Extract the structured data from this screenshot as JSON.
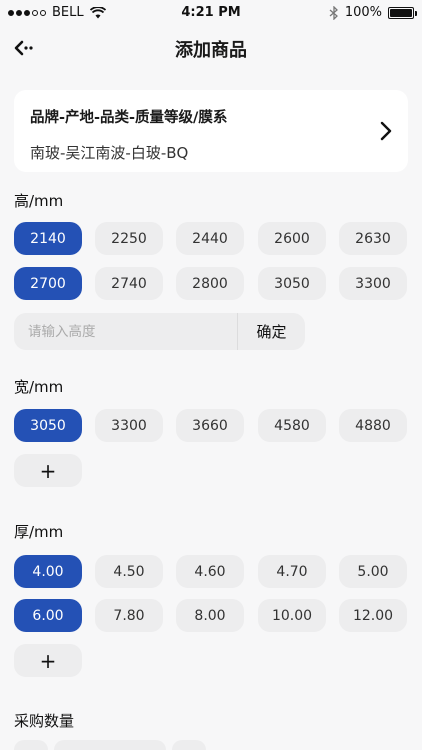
{
  "status_bar": {
    "carrier": "BELL",
    "time": "4:21 PM",
    "battery": "100%"
  },
  "nav": {
    "title": "添加商品"
  },
  "card": {
    "title": "品牌-产地-品类-质量等级/膜系",
    "value": "南玻-吴江南波-白玻-BQ"
  },
  "height": {
    "label": "高/mm",
    "options": [
      "2140",
      "2250",
      "2440",
      "2600",
      "2630",
      "2700",
      "2740",
      "2800",
      "3050",
      "3300"
    ],
    "selected": [
      "2140",
      "2700"
    ],
    "input_placeholder": "请输入高度",
    "confirm_label": "确定"
  },
  "width": {
    "label": "宽/mm",
    "options": [
      "3050",
      "3300",
      "3660",
      "4580",
      "4880"
    ],
    "selected": [
      "3050"
    ],
    "add_label": "+"
  },
  "thickness": {
    "label": "厚/mm",
    "options": [
      "4.00",
      "4.50",
      "4.60",
      "4.70",
      "5.00",
      "6.00",
      "7.80",
      "8.00",
      "10.00",
      "12.00"
    ],
    "selected": [
      "4.00",
      "6.00"
    ],
    "add_label": "+"
  },
  "quantity": {
    "label": "采购数量"
  }
}
